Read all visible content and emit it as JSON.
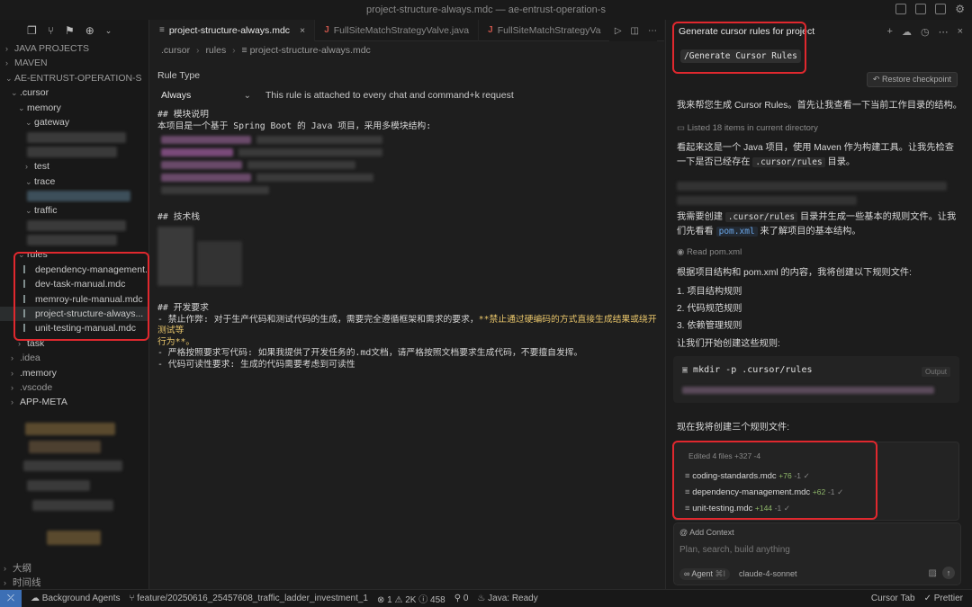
{
  "window": {
    "title": "project-structure-always.mdc — ae-entrust-operation-s"
  },
  "sidebar": {
    "sections": {
      "java_projects": "JAVA PROJECTS",
      "maven": "MAVEN",
      "root": "AE-ENTRUST-OPERATION-S"
    },
    "tree": {
      "cursor": ".cursor",
      "memory": "memory",
      "gateway": "gateway",
      "test": "test",
      "trace": "trace",
      "traffic": "traffic",
      "rules": "rules",
      "rule_files": [
        "dependency-management...",
        "dev-task-manual.mdc",
        "memroy-rule-manual.mdc",
        "project-structure-always...",
        "unit-testing-manual.mdc"
      ],
      "task": "task",
      "idea": ".idea",
      "memory_root": ".memory",
      "vscode": ".vscode",
      "app_meta": "APP-META",
      "outline": "大纲",
      "timeline": "时间线"
    }
  },
  "editor": {
    "tabs": [
      {
        "label": "project-structure-always.mdc",
        "icon": "md-file-icon"
      },
      {
        "label": "FullSiteMatchStrategyValve.java",
        "icon": "java-icon"
      },
      {
        "label": "FullSiteMatchStrategyVa",
        "icon": "java-icon"
      }
    ],
    "breadcrumb": [
      ".cursor",
      "rules",
      "project-structure-always.mdc"
    ],
    "rule_type_label": "Rule Type",
    "rule_type_value": "Always",
    "rule_type_desc": "This rule is attached to every chat and command+k request",
    "lines": {
      "h_module": "## 模块说明",
      "intro": "本项目是一个基于 Spring Boot 的 Java 项目，采用多模块结构:",
      "h_tech": "## 技术栈",
      "h_dev": "## 开发要求",
      "req1_a": "- 禁止作弊: 对于生产代码和测试代码的生成，需要完全遵循框架和需求的要求，",
      "req1_b": "**禁止通过硬编码的方式直接生成结果或绕开测试等",
      "req1_c": "行为**。",
      "req2": "- 严格按照要求写代码: 如果我提供了开发任务的.md文档，请严格按照文档要求生成代码，不要擅自发挥。",
      "req3": "- 代码可读性要求: 生成的代码需要考虑到可读性"
    }
  },
  "chat": {
    "title": "Generate cursor rules for project",
    "command": "/Generate Cursor Rules",
    "restore": "Restore checkpoint",
    "p1": "我来帮您生成 Cursor Rules。首先让我查看一下当前工作目录的结构。",
    "tool1": "Listed 18 items in current directory",
    "p2_a": "看起来这是一个 Java 项目，使用 Maven 作为构建工具。让我先检查一下是否已经存在",
    "p2_code": ".cursor/rules",
    "p2_b": "目录。",
    "p3_a": "我需要创建",
    "p3_code": ".cursor/rules",
    "p3_b": "目录并生成一些基本的规则文件。让我们先看看",
    "p3_code2": "pom.xml",
    "p3_c": "来了解项目的基本结构。",
    "tool2": "Read pom.xml",
    "p4": "根据项目结构和 pom.xml 的内容，我将创建以下规则文件:",
    "list": [
      "1. 项目结构规则",
      "2. 代码规范规则",
      "3. 依赖管理规则"
    ],
    "p5": "让我们开始创建这些规则:",
    "terminal_cmd": "mkdir -p .cursor/rules",
    "terminal_badge": "Output",
    "p6": "现在我将创建三个规则文件:",
    "edited_header": "Edited 4 files +327 -4",
    "edited_files": [
      {
        "name": "coding-standards.mdc",
        "plus": "+76",
        "minus": "-1"
      },
      {
        "name": "dependency-management.mdc",
        "plus": "+62",
        "minus": "-1"
      },
      {
        "name": "unit-testing.mdc",
        "plus": "+144",
        "minus": "-1"
      }
    ],
    "add_context": "Add Context",
    "placeholder": "Plan, search, build anything",
    "agent": "Agent",
    "agent_shortcut": "⌘I",
    "model": "claude-4-sonnet"
  },
  "statusbar": {
    "background_agents": "Background Agents",
    "branch": "feature/20250616_25457608_traffic_ladder_investment_1",
    "errors": "1",
    "warnings": "2K",
    "infos": "458",
    "ports": "0",
    "java": "Java: Ready",
    "cursor_tab": "Cursor Tab",
    "prettier": "Prettier"
  },
  "colors": {
    "highlight": "#e0282e",
    "accent_blue": "#3c6fb5",
    "bold_text": "#e8c56a"
  }
}
